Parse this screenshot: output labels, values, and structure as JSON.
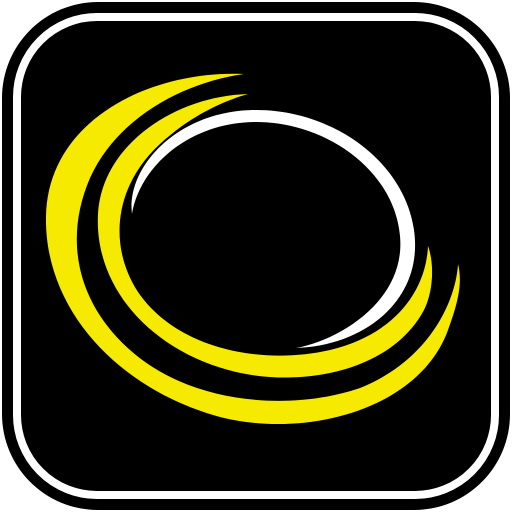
{
  "icon": {
    "name": "swirl-ring-app-icon",
    "colors": {
      "background": "#ffffff",
      "tile": "#000000",
      "border": "#ffffff",
      "outer_swoosh": "#f5ea00",
      "inner_swoosh": "#f5ea00",
      "ring": "#ffffff"
    }
  }
}
